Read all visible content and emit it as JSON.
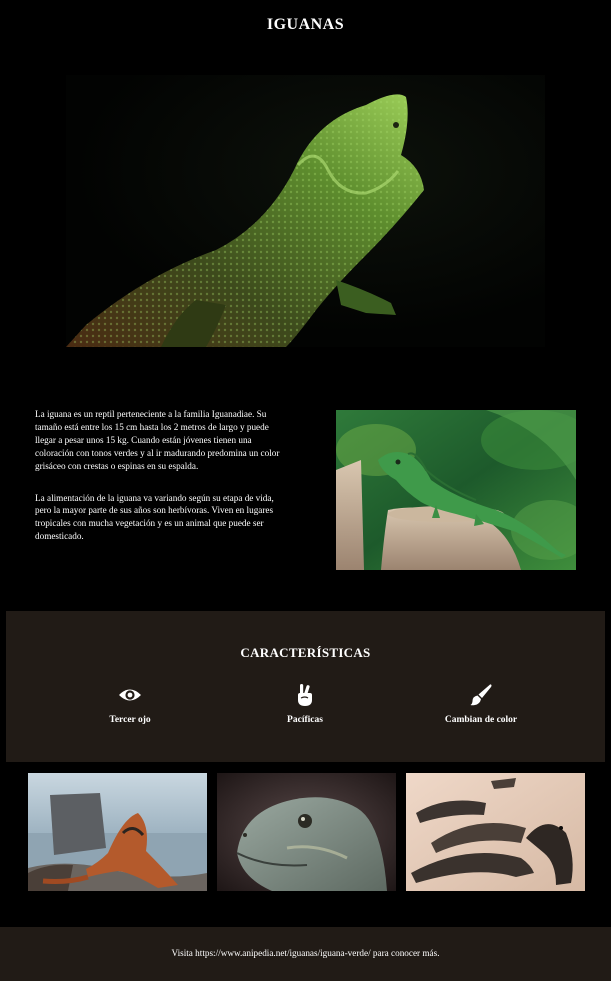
{
  "page": {
    "title": "IGUANAS"
  },
  "intro": {
    "paragraphs": [
      "La iguana es un reptil perteneciente a la familia Iguanadiae. Su tamaño está entre los 15 cm hasta los 2 metros de largo y puede llegar a pesar unos 15 kg. Cuando están jóvenes tienen una coloración con tonos verdes y al ir madurando predomina un color grisáceo con crestas o espinas en su espalda.",
      "La alimentación de la iguana va variando según su etapa de vida, pero la mayor parte de sus años son herbívoras. Viven en lugares tropicales con mucha vegetación y es un animal que puede ser domesticado."
    ]
  },
  "features": {
    "title": "CARACTERÍSTICAS",
    "items": [
      {
        "icon": "eye-icon",
        "label": "Tercer ojo"
      },
      {
        "icon": "peace-hand-icon",
        "label": "Pacíficas"
      },
      {
        "icon": "paintbrush-icon",
        "label": "Cambian de color"
      }
    ]
  },
  "footer": {
    "text": "Visita https://www.anipedia.net/iguanas/iguana-verde/ para conocer más."
  },
  "colors": {
    "background": "#000000",
    "section_bg": "#211b16",
    "text": "#ffffff",
    "lizard_green": "#6fae3a"
  }
}
